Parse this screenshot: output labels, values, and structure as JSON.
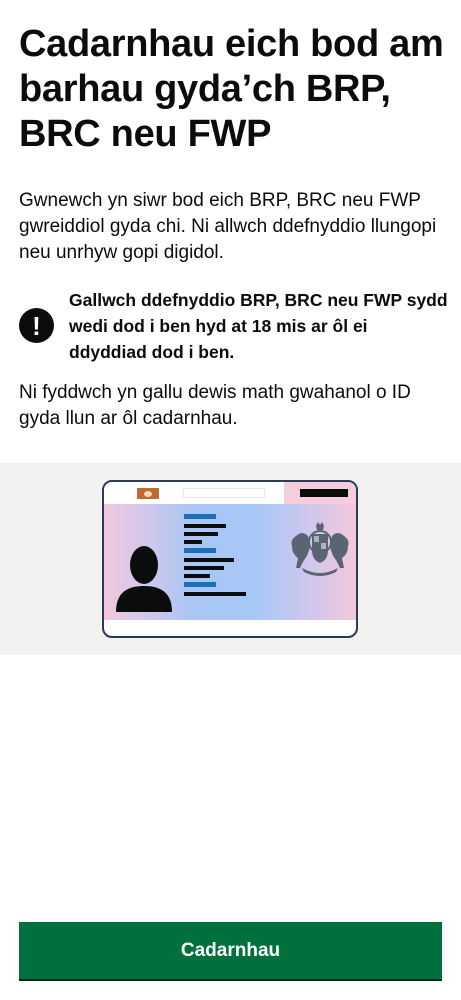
{
  "page": {
    "title": "Cadarnhau eich bod am barhau gyda’ch BRP, BRC neu FWP",
    "intro": "Gwnewch yn siwr bod eich BRP, BRC neu FWP gwreiddiol gyda chi. Ni allwch ddefnyddio llungopi neu unrhyw gopi digidol.",
    "warning": {
      "icon": "!",
      "text": "Gallwch ddefnyddio BRP, BRC neu FWP sydd wedi dod i ben hyd at 18 mis ar ôl ei ddyddiad dod i ben."
    },
    "note": "Ni fyddwch yn gallu dewis math gwahanol o ID gyda llun ar ôl cadarnhau.",
    "confirm_button": "Cadarnhau"
  },
  "colors": {
    "button": "#00703c",
    "text": "#0b0c0c",
    "illustration_bg": "#f3f2f1"
  }
}
